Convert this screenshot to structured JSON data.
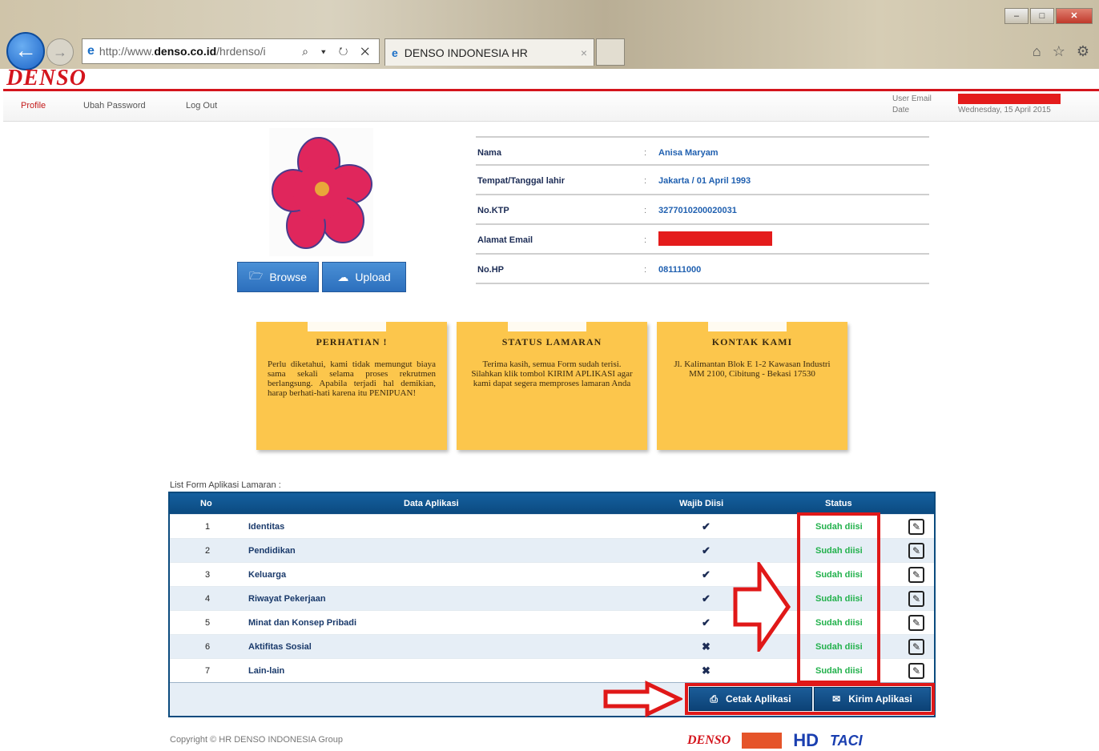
{
  "browser": {
    "url_prefix": "http://www.",
    "url_domain": "denso.co.id",
    "url_suffix": "/hrdenso/i",
    "tab_title": "DENSO INDONESIA HR",
    "controls": "⌕ ▾ ↻ ✕"
  },
  "site": {
    "logo": "DENSO",
    "menu": [
      "Profile",
      "Ubah Password",
      "Log Out"
    ],
    "user_email_label": "User Email",
    "date_label": "Date",
    "date_value": "Wednesday, 15 April 2015"
  },
  "profile": {
    "browse_label": "Browse",
    "upload_label": "Upload",
    "fields": [
      {
        "label": "Nama",
        "value": "Anisa Maryam"
      },
      {
        "label": "Tempat/Tanggal lahir",
        "value": "Jakarta / 01 April 1993"
      },
      {
        "label": "No.KTP",
        "value": "3277010200020031"
      },
      {
        "label": "Alamat Email",
        "value": ""
      },
      {
        "label": "No.HP",
        "value": "081111000"
      }
    ]
  },
  "notes": [
    {
      "title": "PERHATIAN !",
      "body": "Perlu diketahui, kami tidak memungut biaya sama sekali selama proses rekrutmen berlangsung. Apabila terjadi hal demikian, harap berhati-hati karena itu PENIPUAN!"
    },
    {
      "title": "STATUS LAMARAN",
      "body": "Terima kasih, semua Form sudah terisi. Silahkan klik tombol KIRIM APLIKASI agar kami dapat segera memproses lamaran Anda"
    },
    {
      "title": "KONTAK KAMI",
      "body": "Jl. Kalimantan Blok E 1-2 Kawasan Industri MM 2100, Cibitung - Bekasi 17530"
    }
  ],
  "list": {
    "caption": "List Form Aplikasi Lamaran :",
    "headers": {
      "no": "No",
      "data": "Data Aplikasi",
      "wajib": "Wajib Diisi",
      "status": "Status"
    },
    "rows": [
      {
        "no": "1",
        "name": "Identitas",
        "required": "✔",
        "status": "Sudah diisi"
      },
      {
        "no": "2",
        "name": "Pendidikan",
        "required": "✔",
        "status": "Sudah diisi"
      },
      {
        "no": "3",
        "name": "Keluarga",
        "required": "✔",
        "status": "Sudah diisi"
      },
      {
        "no": "4",
        "name": "Riwayat Pekerjaan",
        "required": "✔",
        "status": "Sudah diisi"
      },
      {
        "no": "5",
        "name": "Minat dan Konsep Pribadi",
        "required": "✔",
        "status": "Sudah diisi"
      },
      {
        "no": "6",
        "name": "Aktifitas Sosial",
        "required": "✖",
        "status": "Sudah diisi"
      },
      {
        "no": "7",
        "name": "Lain-lain",
        "required": "✖",
        "status": "Sudah diisi"
      }
    ],
    "print_label": "Cetak Aplikasi",
    "send_label": "Kirim Aplikasi"
  },
  "footer": {
    "copyright": "Copyright © HR DENSO INDONESIA Group",
    "logo_denso": "DENSO",
    "logo_hd": "HD",
    "logo_tac": "TACI"
  },
  "colors": {
    "brand_red": "#d4151d",
    "table_blue": "#0b4a80",
    "note_yellow": "#fcc64c",
    "status_green": "#22b14c",
    "highlight_red": "#e01818"
  },
  "icons": {
    "back": "back-arrow-icon",
    "forward": "forward-arrow-icon",
    "browse": "folder-open-icon",
    "upload": "cloud-upload-icon",
    "edit": "edit-icon",
    "print": "printer-icon",
    "send": "envelope-icon"
  }
}
